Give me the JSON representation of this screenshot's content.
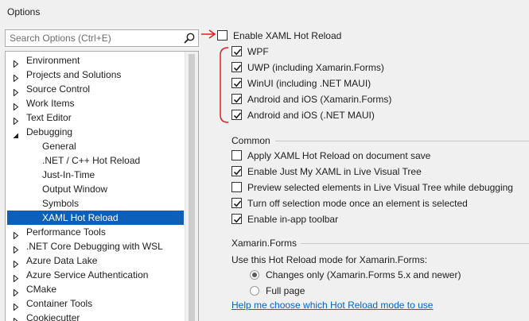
{
  "window": {
    "title": "Options"
  },
  "search": {
    "placeholder": "Search Options (Ctrl+E)"
  },
  "tree": {
    "items": [
      {
        "label": "Environment",
        "expander": "collapsed",
        "level": 0
      },
      {
        "label": "Projects and Solutions",
        "expander": "collapsed",
        "level": 0
      },
      {
        "label": "Source Control",
        "expander": "collapsed",
        "level": 0
      },
      {
        "label": "Work Items",
        "expander": "collapsed",
        "level": 0
      },
      {
        "label": "Text Editor",
        "expander": "collapsed",
        "level": 0
      },
      {
        "label": "Debugging",
        "expander": "expanded",
        "level": 0
      },
      {
        "label": "General",
        "expander": "none",
        "level": 1
      },
      {
        "label": ".NET / C++ Hot Reload",
        "expander": "none",
        "level": 1
      },
      {
        "label": "Just-In-Time",
        "expander": "none",
        "level": 1
      },
      {
        "label": "Output Window",
        "expander": "none",
        "level": 1
      },
      {
        "label": "Symbols",
        "expander": "none",
        "level": 1
      },
      {
        "label": "XAML Hot Reload",
        "expander": "none",
        "level": 1,
        "selected": true
      },
      {
        "label": "Performance Tools",
        "expander": "collapsed",
        "level": 0
      },
      {
        "label": ".NET Core Debugging with WSL",
        "expander": "collapsed",
        "level": 0
      },
      {
        "label": "Azure Data Lake",
        "expander": "collapsed",
        "level": 0
      },
      {
        "label": "Azure Service Authentication",
        "expander": "collapsed",
        "level": 0
      },
      {
        "label": "CMake",
        "expander": "collapsed",
        "level": 0
      },
      {
        "label": "Container Tools",
        "expander": "collapsed",
        "level": 0
      },
      {
        "label": "Cookiecutter",
        "expander": "collapsed",
        "level": 0
      }
    ]
  },
  "hot_reload": {
    "enable": {
      "label": "Enable XAML Hot Reload",
      "checked": false
    },
    "platforms": [
      {
        "label": "WPF",
        "checked": true
      },
      {
        "label": "UWP (including Xamarin.Forms)",
        "checked": true
      },
      {
        "label": "WinUI (including .NET MAUI)",
        "checked": true
      },
      {
        "label": "Android and iOS (Xamarin.Forms)",
        "checked": true
      },
      {
        "label": "Android and iOS (.NET MAUI)",
        "checked": true
      }
    ]
  },
  "common": {
    "title": "Common",
    "options": [
      {
        "label": "Apply XAML Hot Reload on document save",
        "checked": false
      },
      {
        "label": "Enable Just My XAML in Live Visual Tree",
        "checked": true
      },
      {
        "label": "Preview selected elements in Live Visual Tree while debugging",
        "checked": false
      },
      {
        "label": "Turn off selection mode once an element is selected",
        "checked": true
      },
      {
        "label": "Enable in-app toolbar",
        "checked": true
      }
    ]
  },
  "xamarin": {
    "title": "Xamarin.Forms",
    "prompt": "Use this Hot Reload mode for Xamarin.Forms:",
    "modes": [
      {
        "label": "Changes only (Xamarin.Forms 5.x and newer)",
        "selected": true
      },
      {
        "label": "Full page",
        "selected": false
      }
    ],
    "help_link": "Help me choose which Hot Reload mode to use"
  },
  "colors": {
    "selection": "#0e5fb7",
    "link": "#0066cc",
    "annotation": "#e02020"
  }
}
